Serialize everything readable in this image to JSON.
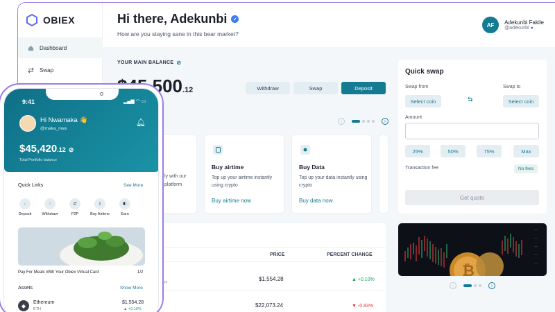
{
  "brand": {
    "name": "OBIEX"
  },
  "sidebar": {
    "items": [
      {
        "label": "Dashboard",
        "icon": "home-icon"
      },
      {
        "label": "Swap",
        "icon": "swap-icon"
      }
    ]
  },
  "header": {
    "greeting": "Hi there, Adekunbi",
    "subtitle": "How are you staying sane in this bear market?"
  },
  "user": {
    "initials": "AF",
    "name": "Adekunbi Fakile",
    "handle": "@adekunbi"
  },
  "balance": {
    "label": "YOUR MAIN BALANCE",
    "main": "$45,500",
    "cents": ".12"
  },
  "actions": {
    "withdraw": "Withdraw",
    "swap": "Swap",
    "deposit": "Deposit"
  },
  "promo_cards": [
    {
      "desc_line1": "ly with our",
      "desc_line2": "platform"
    },
    {
      "title": "Buy airtime",
      "desc": "Top up your airtime instantly using crypto",
      "link": "Buy airtime now"
    },
    {
      "title": "Buy Data",
      "desc": "Top up your data instantly using crypto",
      "link": "Buy data now"
    }
  ],
  "table": {
    "headers": {
      "price": "PRICE",
      "change": "PERCENT CHANGE"
    },
    "rows": [
      {
        "price": "$1,554.28",
        "change": "+0.10%",
        "dir": "up"
      },
      {
        "price": "$22,073.24",
        "change": "-0.83%",
        "dir": "down"
      }
    ],
    "row1_fragment": "n"
  },
  "swap": {
    "title": "Quick swap",
    "from_label": "Swap from",
    "to_label": "Swap to",
    "from_btn": "Select coin",
    "to_btn": "Select coin",
    "amount_label": "Amount",
    "pcts": [
      "25%",
      "50%",
      "75%",
      "Max"
    ],
    "fee_label": "Transaction fee",
    "fee_value": "No fees",
    "quote_btn": "Get quote"
  },
  "phone": {
    "time": "9:41",
    "greeting": "Hi Nwamaka 👋",
    "handle": "@maka_nwa",
    "balance_main": "$45,420",
    "balance_cents": ".12",
    "balance_label": "Total Portfolio balance",
    "quick_links_title": "Quick Links",
    "see_more": "See More",
    "links": [
      {
        "label": "Deposit",
        "icon": "deposit-icon"
      },
      {
        "label": "Withdraw",
        "icon": "withdraw-icon"
      },
      {
        "label": "P2P",
        "icon": "p2p-icon"
      },
      {
        "label": "Buy Airtime",
        "icon": "airtime-icon"
      },
      {
        "label": "Earn",
        "icon": "earn-icon"
      }
    ],
    "banner_caption": "Pay For Meals With Your Obiex Virtual Card",
    "banner_page": "1/2",
    "assets_title": "Assets",
    "show_more": "Show More",
    "asset": {
      "name": "Ethereum",
      "symbol": "ETH",
      "price": "$1,554.28",
      "change": "+0.10%"
    }
  },
  "colors": {
    "accent": "#157b93",
    "frame": "#9b7be8",
    "up": "#17a05d",
    "down": "#e0383e"
  }
}
